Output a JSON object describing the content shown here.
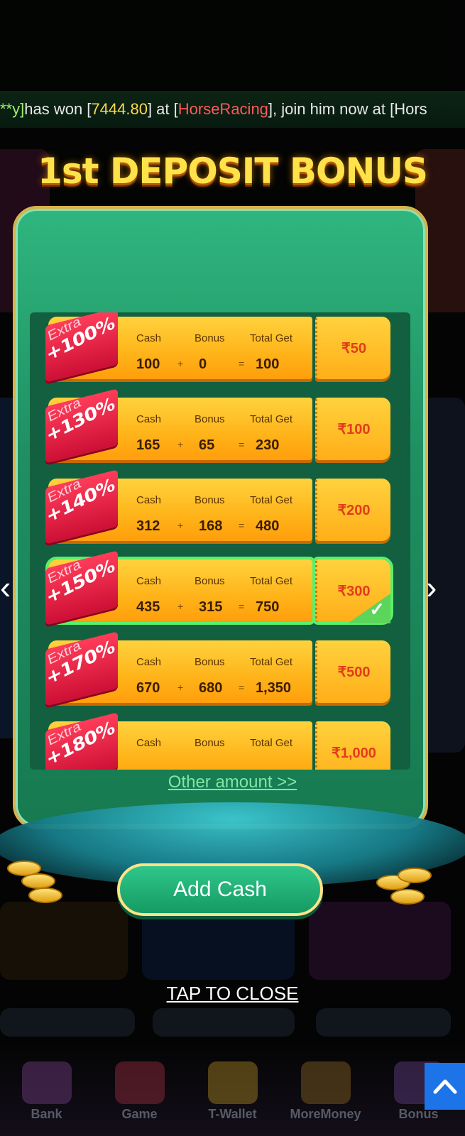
{
  "marquee": {
    "prefix": "**y]",
    "text1": " has won [",
    "amount": "7444.80",
    "text2": "] at [",
    "game": "HorseRacing",
    "text3": "], join him now at [Hors"
  },
  "modal": {
    "title": "1st DEPOSIT BONUS",
    "column_labels": {
      "cash": "Cash",
      "bonus": "Bonus",
      "total": "Total Get"
    },
    "rows": [
      {
        "extra": "Extra",
        "pct": "+100%",
        "cash": "100",
        "bonus": "0",
        "total": "100",
        "price": "₹50",
        "selected": false
      },
      {
        "extra": "Extra",
        "pct": "+130%",
        "cash": "165",
        "bonus": "65",
        "total": "230",
        "price": "₹100",
        "selected": false
      },
      {
        "extra": "Extra",
        "pct": "+140%",
        "cash": "312",
        "bonus": "168",
        "total": "480",
        "price": "₹200",
        "selected": false
      },
      {
        "extra": "Extra",
        "pct": "+150%",
        "cash": "435",
        "bonus": "315",
        "total": "750",
        "price": "₹300",
        "selected": true
      },
      {
        "extra": "Extra",
        "pct": "+170%",
        "cash": "670",
        "bonus": "680",
        "total": "1,350",
        "price": "₹500",
        "selected": false
      },
      {
        "extra": "Extra",
        "pct": "+180%",
        "cash": "",
        "bonus": "",
        "total": "",
        "price": "₹1,000",
        "selected": false
      }
    ],
    "plus": "+",
    "equals": "=",
    "other_amount": "Other amount >>",
    "add_cash": "Add Cash",
    "tap_to_close": "TAP TO CLOSE"
  },
  "nav": {
    "left_arrow": "‹",
    "right_arrow": "›"
  },
  "bottom_nav": [
    {
      "label": "Bank"
    },
    {
      "label": "Game"
    },
    {
      "label": "T-Wallet"
    },
    {
      "label": "MoreMoney"
    },
    {
      "label": "Bonus"
    }
  ],
  "colors": {
    "accent_green": "#2fb67f",
    "accent_gold": "#ffd23d",
    "ribbon_red": "#cc0f35",
    "price_red": "#e33b1c",
    "scroll_top_blue": "#1c74e8"
  },
  "icons": [
    "chevron-left-icon",
    "chevron-right-icon",
    "checkmark-icon",
    "arrow-up-icon"
  ]
}
